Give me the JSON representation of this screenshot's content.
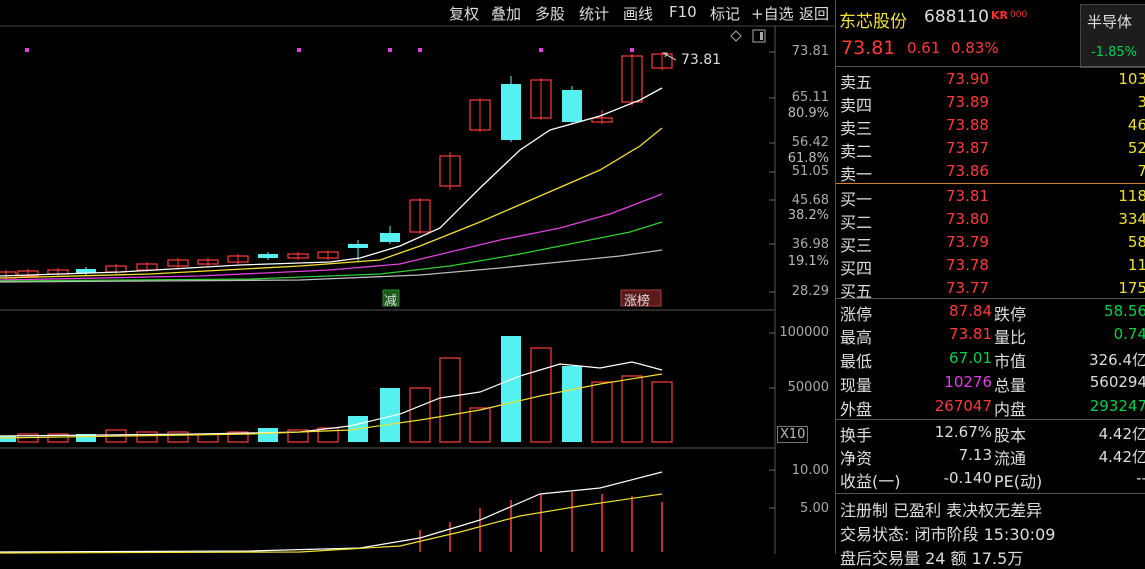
{
  "menu": [
    "复权",
    "叠加",
    "多股",
    "统计",
    "画线",
    "F10",
    "标记",
    "+自选",
    "返回"
  ],
  "chart": {
    "price_axis": [
      "73.81",
      "65.11",
      "56.42",
      "51.05",
      "45.68",
      "36.98",
      "28.29"
    ],
    "pct_axis": [
      "80.9%",
      "61.8%",
      "38.2%",
      "19.1%"
    ],
    "last_price_marker": "73.81",
    "vol_axis": [
      "100000",
      "50000"
    ],
    "vol_unit": "X10",
    "ind_axis": [
      "10.00",
      "5.00"
    ],
    "tag_reduce": "减",
    "tag_limitup": "涨榜"
  },
  "header": {
    "name": "东芯股份",
    "code": "688110",
    "kr": "KR",
    "price": "73.81",
    "change": "0.61",
    "change_pct": "0.83%",
    "sector": "半导体",
    "sector_pct": "-1.85%"
  },
  "orderbook": {
    "sell": [
      {
        "label": "卖五",
        "price": "73.90",
        "vol": "103"
      },
      {
        "label": "卖四",
        "price": "73.89",
        "vol": "3"
      },
      {
        "label": "卖三",
        "price": "73.88",
        "vol": "46"
      },
      {
        "label": "卖二",
        "price": "73.87",
        "vol": "52"
      },
      {
        "label": "卖一",
        "price": "73.86",
        "vol": "7"
      }
    ],
    "buy": [
      {
        "label": "买一",
        "price": "73.81",
        "vol": "118"
      },
      {
        "label": "买二",
        "price": "73.80",
        "vol": "334"
      },
      {
        "label": "买三",
        "price": "73.79",
        "vol": "58"
      },
      {
        "label": "买四",
        "price": "73.78",
        "vol": "11"
      },
      {
        "label": "买五",
        "price": "73.77",
        "vol": "175"
      }
    ]
  },
  "stats": [
    {
      "l1": "涨停",
      "v1": "87.84",
      "c1": "#ff3b3b",
      "l2": "跌停",
      "v2": "58.56",
      "c2": "#00d050"
    },
    {
      "l1": "最高",
      "v1": "73.81",
      "c1": "#ff3b3b",
      "l2": "量比",
      "v2": "0.74",
      "c2": "#00d050"
    },
    {
      "l1": "最低",
      "v1": "67.01",
      "c1": "#00d050",
      "l2": "市值",
      "v2": "326.4亿",
      "c2": "#ddd"
    },
    {
      "l1": "现量",
      "v1": "10276",
      "c1": "#e040e0",
      "l2": "总量",
      "v2": "560294",
      "c2": "#ddd"
    },
    {
      "l1": "外盘",
      "v1": "267047",
      "c1": "#ff3b3b",
      "l2": "内盘",
      "v2": "293247",
      "c2": "#00d050"
    }
  ],
  "stats2": [
    {
      "l1": "换手",
      "v1": "12.67%",
      "c1": "#ddd",
      "l2": "股本",
      "v2": "4.42亿",
      "c2": "#ddd"
    },
    {
      "l1": "净资",
      "v1": "7.13",
      "c1": "#ddd",
      "l2": "流通",
      "v2": "4.42亿",
      "c2": "#ddd"
    },
    {
      "l1": "收益(一)",
      "v1": "-0.140",
      "c1": "#ddd",
      "l2": "PE(动)",
      "v2": "--",
      "c2": "#ddd"
    }
  ],
  "info": {
    "line1": "注册制 已盈利 表决权无差异",
    "line2": "交易状态: 闭市阶段 15:30:09",
    "line3": "盘后交易量 24 额 17.5万"
  },
  "colors": {
    "up": "#ff3b3b",
    "down": "#00d050",
    "cyan": "#55f0f0",
    "yellow": "#f0e030",
    "magenta": "#e040e0"
  }
}
